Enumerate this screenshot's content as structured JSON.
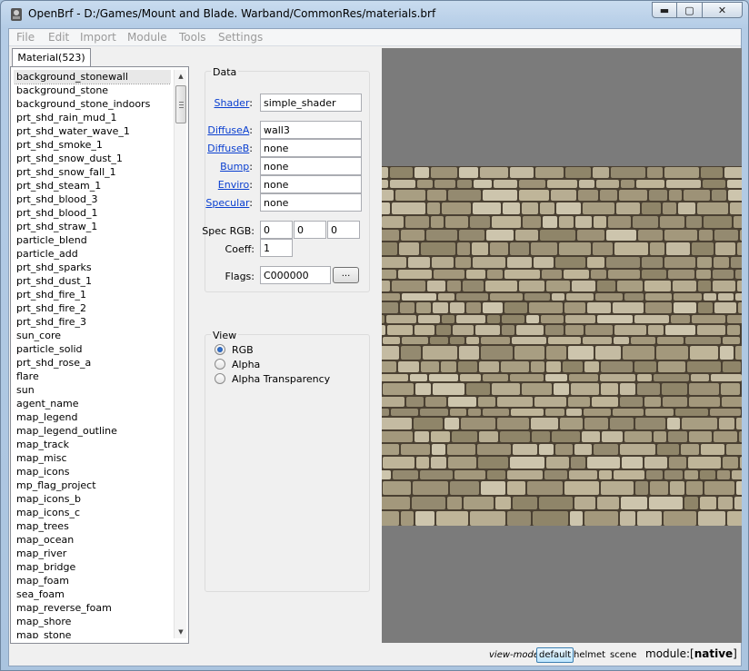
{
  "window": {
    "title": "OpenBrf - D:/Games/Mount and Blade. Warband/CommonRes/materials.brf",
    "minimize_icon": "minimize-icon",
    "maximize_icon": "maximize-icon",
    "close_icon": "close-icon"
  },
  "menu": [
    "File",
    "Edit",
    "Import",
    "Module",
    "Tools",
    "Settings"
  ],
  "tab": {
    "label": "Material(523)"
  },
  "materials": [
    "background_stonewall",
    "background_stone",
    "background_stone_indoors",
    "prt_shd_rain_mud_1",
    "prt_shd_water_wave_1",
    "prt_shd_smoke_1",
    "prt_shd_snow_dust_1",
    "prt_shd_snow_fall_1",
    "prt_shd_steam_1",
    "prt_shd_blood_3",
    "prt_shd_blood_1",
    "prt_shd_straw_1",
    "particle_blend",
    "particle_add",
    "prt_shd_sparks",
    "prt_shd_dust_1",
    "prt_shd_fire_1",
    "prt_shd_fire_2",
    "prt_shd_fire_3",
    "sun_core",
    "particle_solid",
    "prt_shd_rose_a",
    "flare",
    "sun",
    "agent_name",
    "map_legend",
    "map_legend_outline",
    "map_track",
    "map_misc",
    "map_icons",
    "mp_flag_project",
    "map_icons_b",
    "map_icons_c",
    "map_trees",
    "map_ocean",
    "map_river",
    "map_bridge",
    "map_foam",
    "sea_foam",
    "map_reverse_foam",
    "map_shore",
    "map_stone"
  ],
  "data": {
    "title": "Data",
    "shader_label": "Shader",
    "shader_value": "simple_shader",
    "diffuseA_label": "DiffuseA",
    "diffuseA_value": "wall3",
    "diffuseB_label": "DiffuseB",
    "diffuseB_value": "none",
    "bump_label": "Bump",
    "bump_value": "none",
    "enviro_label": "Enviro",
    "enviro_value": "none",
    "specular_label": "Specular",
    "specular_value": "none",
    "spec_rgb_label": "Spec RGB:",
    "spec_r": "0",
    "spec_g": "0",
    "spec_b": "0",
    "coeff_label": "Coeff:",
    "coeff_value": "1",
    "flags_label": "Flags:",
    "flags_value": "C000000",
    "flags_button": "..."
  },
  "view": {
    "title": "View",
    "options": [
      "RGB",
      "Alpha",
      "Alpha Transparency"
    ],
    "selected": "RGB"
  },
  "status": {
    "view_mode_label": "view-mode:",
    "modes": [
      "default",
      "helmet",
      "scene"
    ],
    "active_mode": "default",
    "module_label": "module:",
    "module_value": "native"
  },
  "colors": {
    "viewport_bg": "#7b7b7b",
    "link": "#0a3fd0",
    "selected_mode": "#bee6fd"
  }
}
